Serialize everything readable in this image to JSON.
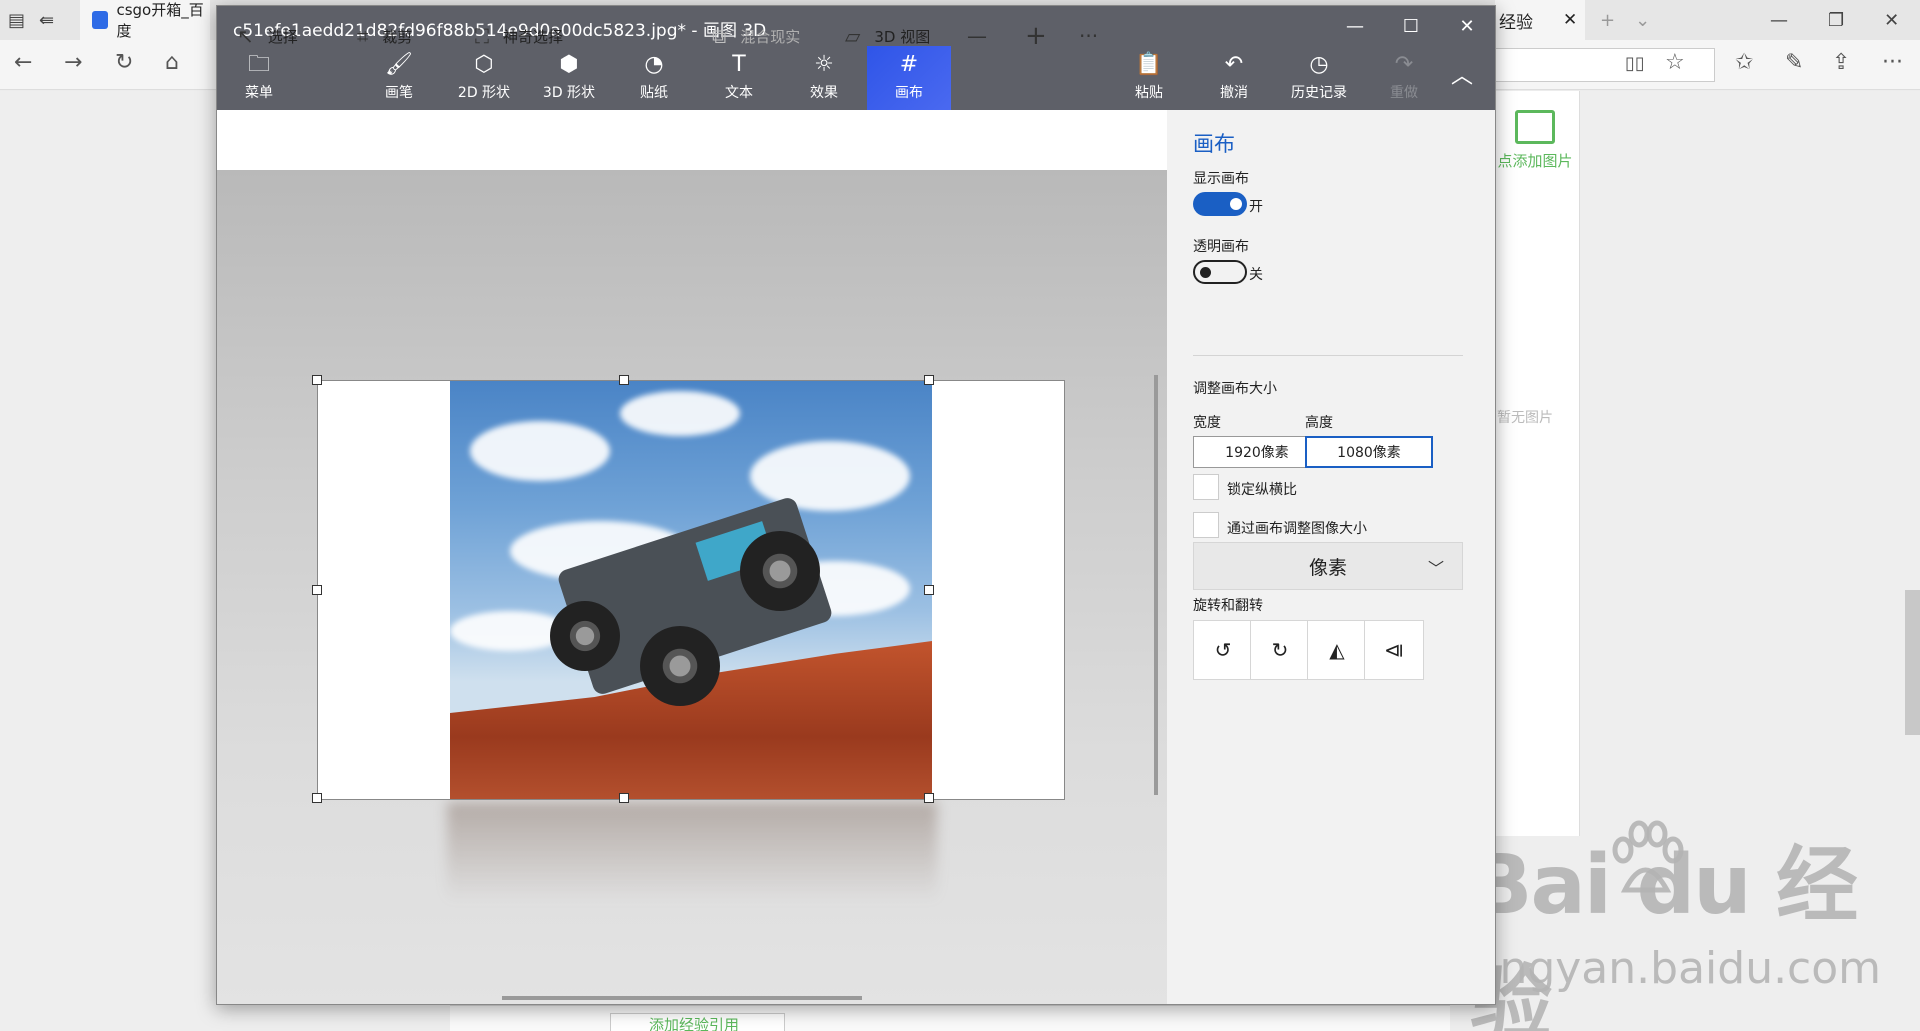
{
  "browser": {
    "tab_title": "csgo开箱_百度",
    "tab2_title": "经验",
    "tab2_close": "✕",
    "new_tab": "+",
    "tab_dropdown": "⌄",
    "page": {
      "add_image_label": "点添加图片",
      "no_image_text": "暂无图片",
      "bottom_button_label": "添加经验引用"
    },
    "watermark": {
      "brand": "Bai du 经验",
      "url": "jingyan.baidu.com"
    }
  },
  "paint3d": {
    "title": "c51efe1aedd21d82fd96f88b514e9d0a00dc5823.jpg* - 画图 3D",
    "window_controls": {
      "minimize": "—",
      "maximize": "☐",
      "close": "✕"
    },
    "toolbar": {
      "menu": "菜单",
      "brush": "画笔",
      "shapes_2d": "2D 形状",
      "shapes_3d": "3D 形状",
      "stickers": "贴纸",
      "text": "文本",
      "effects": "效果",
      "canvas": "画布",
      "paste": "粘贴",
      "undo": "撤消",
      "history": "历史记录",
      "redo": "重做"
    },
    "subtoolbar": {
      "select": "选择",
      "crop": "裁剪",
      "magic_select": "神奇选择",
      "mixed_reality": "混合现实",
      "view_3d": "3D 视图",
      "zoom_out": "—",
      "zoom_in": "+",
      "more": "···"
    },
    "panel": {
      "title": "画布",
      "show_canvas_label": "显示画布",
      "show_canvas_state": "开",
      "transparent_canvas_label": "透明画布",
      "transparent_canvas_state": "关",
      "resize_label": "调整画布大小",
      "width_label": "宽度",
      "height_label": "高度",
      "width_value": "1920像素",
      "height_value": "1080像素",
      "lock_aspect_label": "锁定纵横比",
      "resize_image_label": "通过画布调整图像大小",
      "unit_select": "像素",
      "rotate_flip_label": "旋转和翻转"
    }
  },
  "colors": {
    "accent": "#1a5fc4",
    "toolbar_bg": "#5e6068",
    "active_tool": "#3a5cec"
  }
}
